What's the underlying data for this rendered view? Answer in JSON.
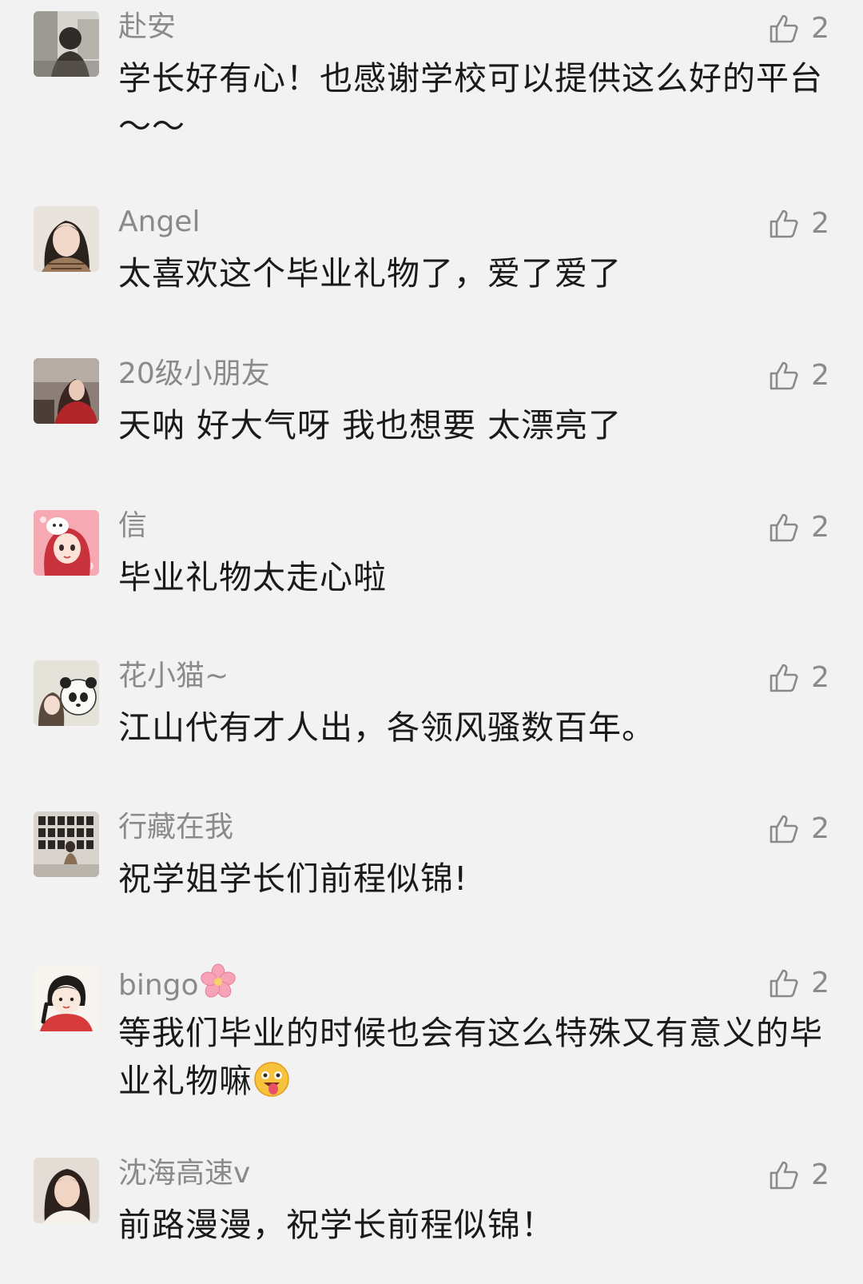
{
  "comments": [
    {
      "nickname": "赴安",
      "text": "学长好有心！也感谢学校可以提供这么好的平台～～",
      "likes": "2",
      "avatar_icon": "photo-avatar-man-icon"
    },
    {
      "nickname": "Angel",
      "text": "太喜欢这个毕业礼物了，爱了爱了",
      "likes": "2",
      "avatar_icon": "photo-avatar-girl-icon"
    },
    {
      "nickname": "20级小朋友",
      "text": "天呐 好大气呀 我也想要 太漂亮了",
      "likes": "2",
      "avatar_icon": "photo-avatar-girl-red-icon"
    },
    {
      "nickname": "信",
      "text": "毕业礼物太走心啦",
      "likes": "2",
      "avatar_icon": "cartoon-avatar-girl-icon"
    },
    {
      "nickname": "花小猫~",
      "text": "江山代有才人出，各领风骚数百年。",
      "likes": "2",
      "avatar_icon": "panda-avatar-icon"
    },
    {
      "nickname": "行藏在我",
      "text": "祝学姐学长们前程似锦!",
      "likes": "2",
      "avatar_icon": "gallery-avatar-icon"
    },
    {
      "nickname": "bingo",
      "nickname_emoji": "cherry-blossom-icon",
      "text": "等我们毕业的时候也会有这么特殊又有意义的毕业礼物嘛",
      "text_emoji": "tongue-face-emoji-icon",
      "likes": "2",
      "avatar_icon": "cartoon-avatar-girl-braids-icon"
    },
    {
      "nickname": "沈海高速v",
      "text": "前路漫漫，祝学长前程似锦！",
      "likes": "2",
      "avatar_icon": "photo-avatar-woman-icon"
    }
  ],
  "like_icon": "thumbs-up-icon",
  "colors": {
    "background": "#f2f2f2",
    "nickname": "#8a8a8a",
    "text": "#1a1a1a",
    "like_icon": "#8a8a8a"
  }
}
